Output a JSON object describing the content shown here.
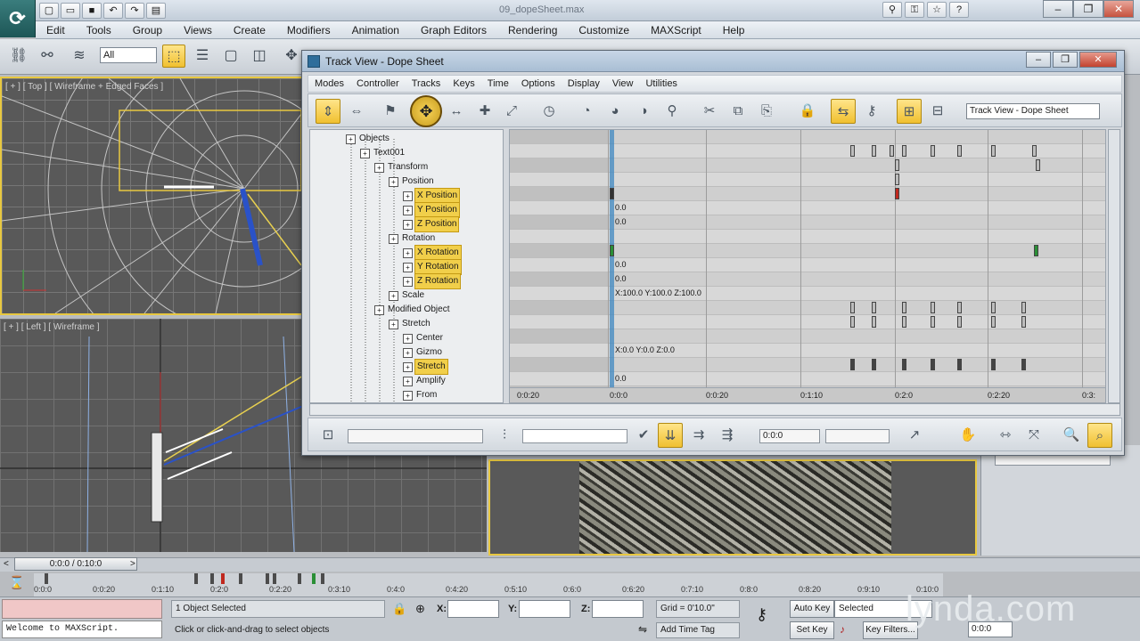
{
  "app": {
    "file_title": "09_dopeSheet.max"
  },
  "main_menu": [
    "Edit",
    "Tools",
    "Group",
    "Views",
    "Create",
    "Modifiers",
    "Animation",
    "Graph Editors",
    "Rendering",
    "Customize",
    "MAXScript",
    "Help"
  ],
  "toolbar": {
    "selection_filter": "All"
  },
  "viewports": {
    "top_label": "[ + ] [ Top ] [ Wireframe + Edged Faces ]",
    "left_label": "[ + ] [ Left ] [ Wireframe ]"
  },
  "dope_sheet": {
    "title": "Track View - Dope Sheet",
    "menu": [
      "Modes",
      "Controller",
      "Tracks",
      "Keys",
      "Time",
      "Options",
      "Display",
      "View",
      "Utilities"
    ],
    "name_field": "Track View - Dope Sheet",
    "hierarchy": [
      {
        "label": "Objects",
        "level": 0,
        "selected": false
      },
      {
        "label": "Text001",
        "level": 1,
        "selected": false
      },
      {
        "label": "Transform",
        "level": 2,
        "selected": false
      },
      {
        "label": "Position",
        "level": 3,
        "selected": false
      },
      {
        "label": "X Position",
        "level": 4,
        "selected": true
      },
      {
        "label": "Y Position",
        "level": 4,
        "selected": true
      },
      {
        "label": "Z Position",
        "level": 4,
        "selected": true
      },
      {
        "label": "Rotation",
        "level": 3,
        "selected": false
      },
      {
        "label": "X Rotation",
        "level": 4,
        "selected": true
      },
      {
        "label": "Y Rotation",
        "level": 4,
        "selected": true
      },
      {
        "label": "Z Rotation",
        "level": 4,
        "selected": true
      },
      {
        "label": "Scale",
        "level": 3,
        "selected": false
      },
      {
        "label": "Modified Object",
        "level": 2,
        "selected": false
      },
      {
        "label": "Stretch",
        "level": 3,
        "selected": false
      },
      {
        "label": "Center",
        "level": 4,
        "selected": false
      },
      {
        "label": "Gizmo",
        "level": 4,
        "selected": false
      },
      {
        "label": "Stretch",
        "level": 4,
        "selected": true
      },
      {
        "label": "Amplify",
        "level": 4,
        "selected": false
      },
      {
        "label": "From",
        "level": 4,
        "selected": false
      }
    ],
    "row_values": {
      "y_position": "0.0",
      "z_position": "0.0",
      "y_rotation": "0.0",
      "z_rotation": "0.0",
      "scale": "X:100.0 Y:100.0 Z:100.0",
      "gizmo": "X:0.0 Y:0.0 Z:0.0",
      "amplify": "0.0"
    },
    "ruler_ticks": [
      "0:0:20",
      "0:0:0",
      "0:0:20",
      "0:1:10",
      "0:2:0",
      "0:2:20",
      "0:3:"
    ],
    "bottom_field": "0:0:0"
  },
  "timeline": {
    "slider_label": "0:0:0 / 0:10:0",
    "ticks": [
      "0:0:0",
      "0:0:20",
      "0:1:10",
      "0:2:0",
      "0:2:20",
      "0:3:10",
      "0:4:0",
      "0:4:20",
      "0:5:10",
      "0:6:0",
      "0:6:20",
      "0:7:10",
      "0:8:0",
      "0:8:20",
      "0:9:10",
      "0:10:0"
    ]
  },
  "status": {
    "listener_text": "Welcome to MAXScript.",
    "selection": "1 Object Selected",
    "prompt": "Click or click-and-drag to select objects",
    "x_label": "X:",
    "y_label": "Y:",
    "z_label": "Z:",
    "grid": "Grid = 0'10.0\"",
    "add_time_tag": "Add Time Tag",
    "auto_key": "Auto Key",
    "selected": "Selected",
    "set_key": "Set Key",
    "key_filters": "Key Filters...",
    "frame": "0:0:0"
  },
  "watermark": "lynda.com",
  "colors": {
    "selection_yellow": "#f1cf4a",
    "timeline_blue": "#3f88c1",
    "key_red": "#c0281e",
    "key_green": "#2a8f36"
  }
}
